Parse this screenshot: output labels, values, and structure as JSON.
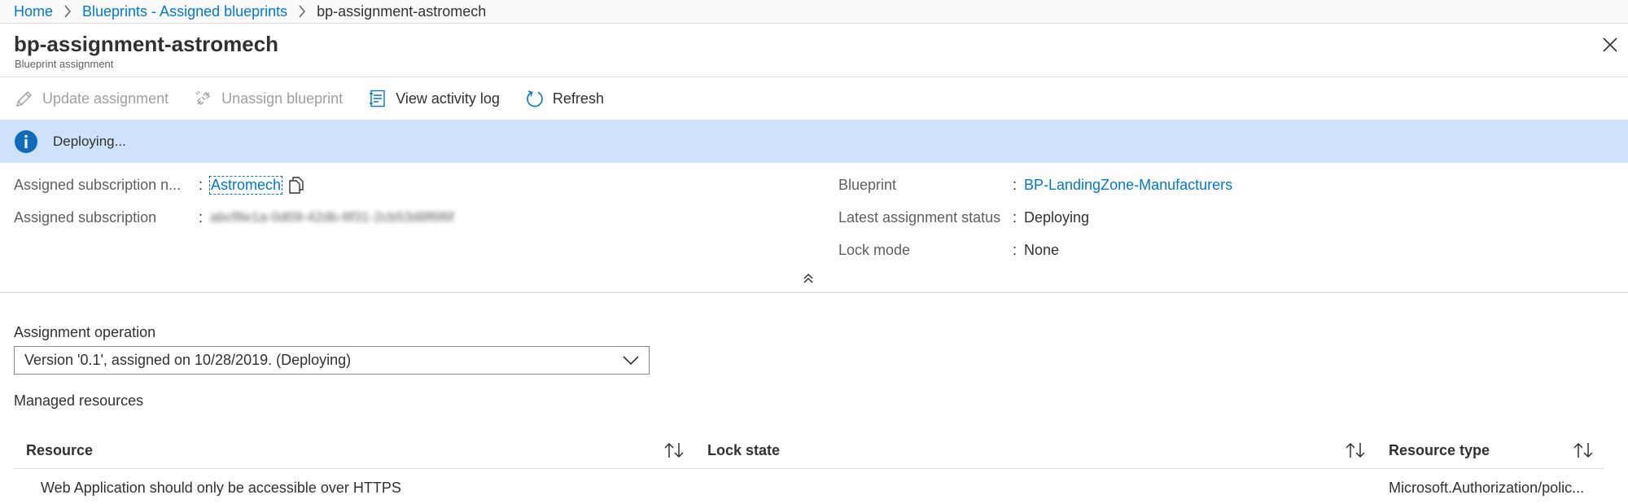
{
  "breadcrumb": {
    "items": [
      "Home",
      "Blueprints - Assigned blueprints"
    ],
    "current": "bp-assignment-astromech"
  },
  "header": {
    "title": "bp-assignment-astromech",
    "subtitle": "Blueprint assignment"
  },
  "toolbar": {
    "update_label": "Update assignment",
    "unassign_label": "Unassign blueprint",
    "activity_label": "View activity log",
    "refresh_label": "Refresh"
  },
  "banner": {
    "text": "Deploying..."
  },
  "essentials": {
    "left": [
      {
        "label": "Assigned subscription n...",
        "value": "Astromech"
      },
      {
        "label": "Assigned subscription",
        "value": "abcf8e1a-0d09-42db-8f31-2cb53d8f6f6f"
      }
    ],
    "right": [
      {
        "label": "Blueprint",
        "value": "BP-LandingZone-Manufacturers"
      },
      {
        "label": "Latest assignment status",
        "value": "Deploying"
      },
      {
        "label": "Lock mode",
        "value": "None"
      }
    ],
    "colon": ":"
  },
  "operation": {
    "label": "Assignment operation",
    "selected": "Version '0.1', assigned on 10/28/2019. (Deploying)"
  },
  "managed": {
    "label": "Managed resources"
  },
  "table": {
    "columns": [
      "Resource",
      "Lock state",
      "Resource type"
    ],
    "rows": [
      {
        "resource": "Web Application should only be accessible over HTTPS",
        "lock_state": "",
        "resource_type": "Microsoft.Authorization/polic..."
      }
    ]
  },
  "colors": {
    "accent": "#0078d4",
    "banner_bg": "#cfe2fb",
    "info_icon": "#0f6cbd",
    "disabled_text": "#a19f9d"
  },
  "icons": {
    "chevron_right": "chevron-right-icon",
    "close": "close-icon",
    "edit": "pencil-icon",
    "unassign": "unlink-icon",
    "activity": "activity-log-icon",
    "refresh": "refresh-icon",
    "info": "info-icon",
    "copy": "copy-icon",
    "collapse": "double-chevron-up-icon",
    "dropdown": "chevron-down-icon",
    "sort": "sort-icon"
  }
}
